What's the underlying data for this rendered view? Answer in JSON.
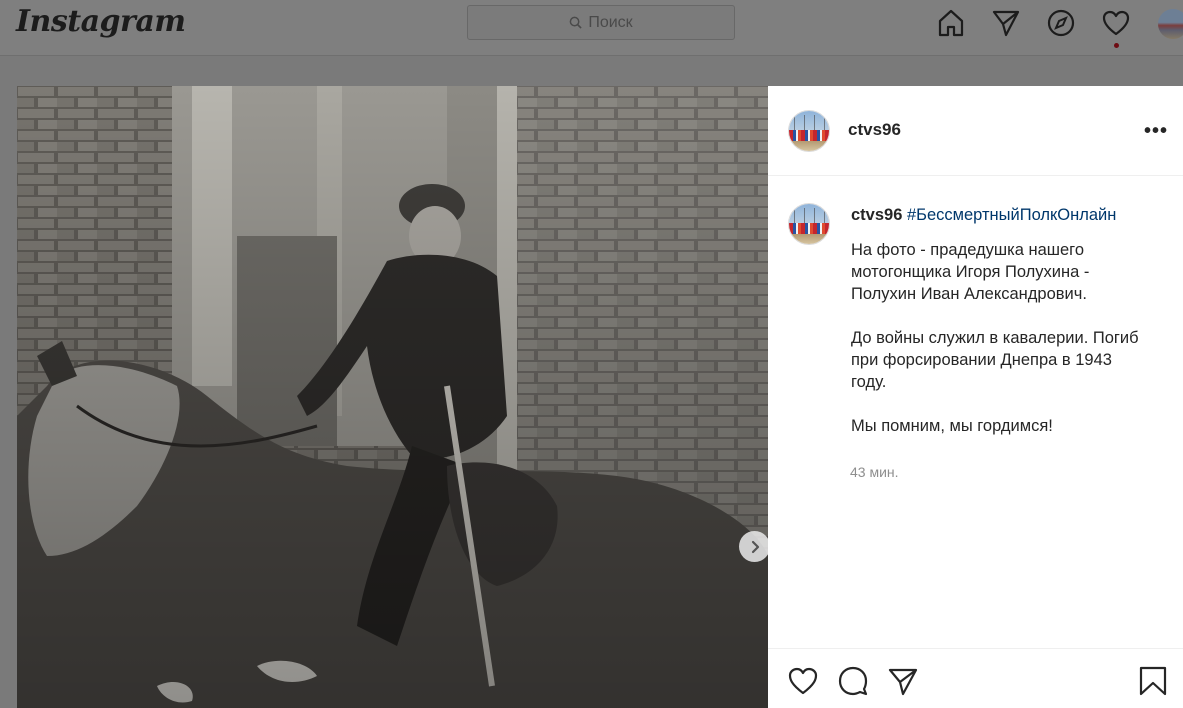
{
  "header": {
    "logo": "Instagram",
    "search_placeholder": "Поиск",
    "nav_icons": [
      "home-icon",
      "direct-icon",
      "explore-icon",
      "activity-heart-icon",
      "profile-avatar"
    ]
  },
  "post": {
    "author": "ctvs96",
    "more_label": "•••",
    "caption": {
      "username": "ctvs96",
      "hashtag": "#БессмертныйПолкОнлайн",
      "paragraph1": "На фото - прадедушка нашего мотогонщика Игоря Полухина - Полухин Иван Александрович.",
      "paragraph2": "До войны служил в кавалерии. Погиб при форсировании Днепра в 1943 году.",
      "paragraph3": "Мы помним, мы гордимся!"
    },
    "timestamp": "43 мин.",
    "action_icons": [
      "like-heart-icon",
      "comment-icon",
      "share-icon",
      "save-bookmark-icon"
    ]
  },
  "colors": {
    "overlay_bg": "#7a7a7a",
    "panel_bg": "#ffffff",
    "hashtag": "#00376b",
    "muted_text": "#8e8e8e"
  }
}
